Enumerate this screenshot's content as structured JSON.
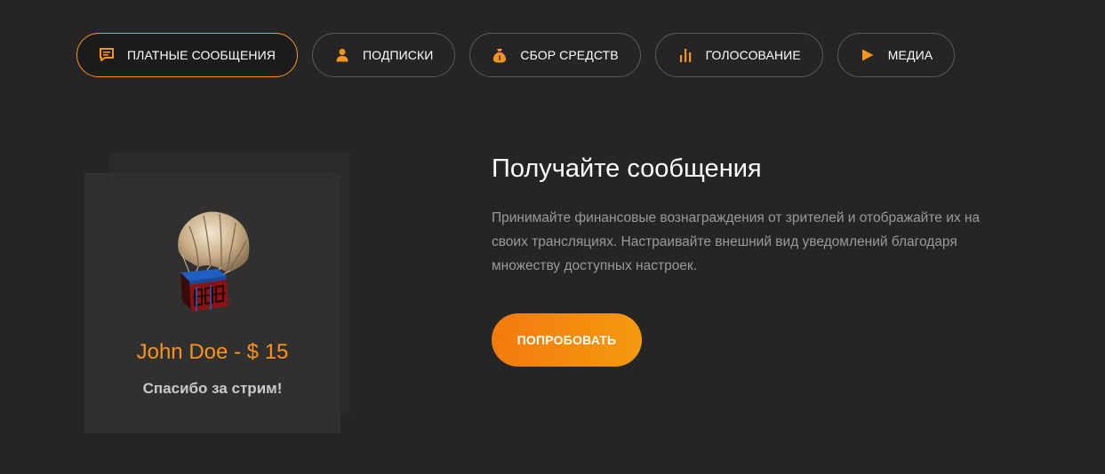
{
  "colors": {
    "background": "#252525",
    "accent": "#f7941d",
    "card": "#303030",
    "heading": "#ffffff",
    "description": "#9a9a9a"
  },
  "tabs": [
    {
      "label": "ПЛАТНЫЕ СООБЩЕНИЯ",
      "icon": "message-icon",
      "active": true
    },
    {
      "label": "ПОДПИСКИ",
      "icon": "user-icon",
      "active": false
    },
    {
      "label": "СБОР СРЕДСТВ",
      "icon": "money-bag-icon",
      "active": false
    },
    {
      "label": "ГОЛОСОВАНИЕ",
      "icon": "bar-chart-icon",
      "active": false
    },
    {
      "label": "МЕДИА",
      "icon": "play-icon",
      "active": false
    }
  ],
  "preview": {
    "image": "airdrop-crate-image",
    "donor": "John Doe - $ 15",
    "message": "Спасибо за стрим!"
  },
  "main": {
    "title": "Получайте сообщения",
    "description": "Принимайте финансовые вознаграждения от зрителей и отображайте их на своих трансляциях. Настраивайте внешний вид уведомлений благодаря множеству доступных настроек.",
    "cta_label": "ПОПРОБОВАТЬ"
  }
}
